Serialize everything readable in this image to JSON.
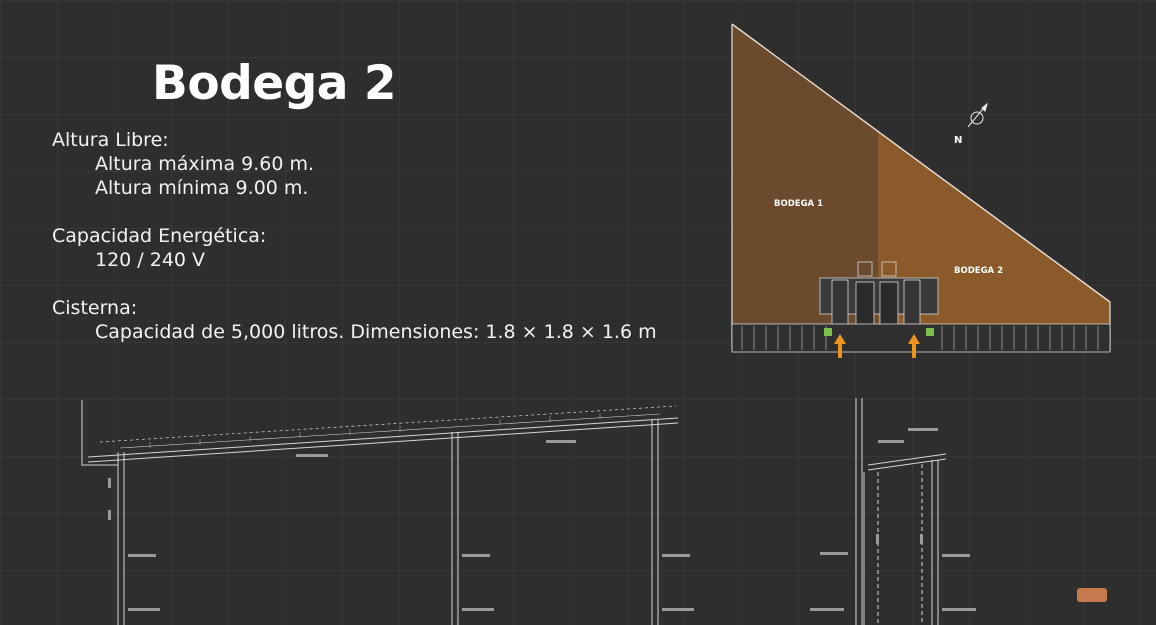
{
  "title": "Bodega 2",
  "altura": {
    "label": "Altura Libre:",
    "max": "Altura máxima 9.60 m.",
    "min": "Altura mínima 9.00 m."
  },
  "energia": {
    "label": "Capacidad Energética:",
    "value": "120 / 240 V"
  },
  "cisterna": {
    "label": "Cisterna:",
    "value": "Capacidad de 5,000 litros. Dimensiones: 1.8 × 1.8 × 1.6 m"
  },
  "plan": {
    "bodega1": "BODEGA 1",
    "bodega2": "BODEGA 2",
    "north": "N",
    "colors": {
      "bodega1": "#6b4a2e",
      "bodega2": "#8a5a2a",
      "arrow": "#f0921e"
    }
  }
}
